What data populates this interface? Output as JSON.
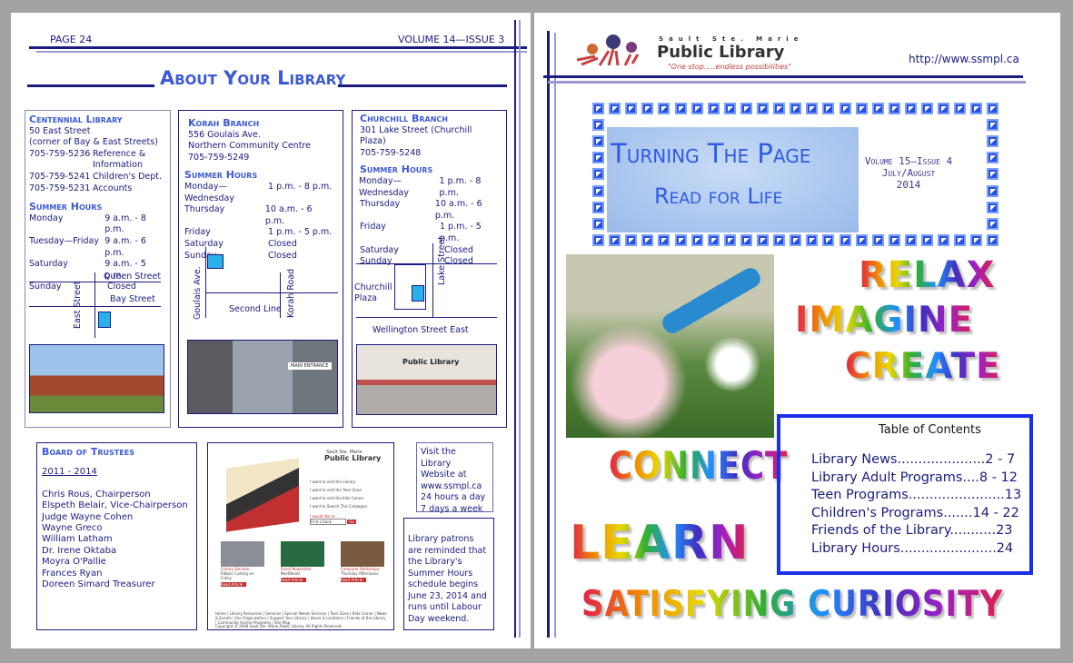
{
  "left": {
    "page_label": "PAGE 24",
    "volume": "VOLUME 14—ISSUE 3",
    "title": "About Your Library",
    "centennial": {
      "name": "Centennial Library",
      "address": "50 East Street",
      "corner": "(corner of Bay & East Streets)",
      "phones": [
        {
          "num": "705-759-5236",
          "dept": "Reference &"
        },
        {
          "num": "",
          "dept": "Information"
        },
        {
          "num": "705-759-5241",
          "dept": "Children's  Dept."
        },
        {
          "num": "705-759-5231",
          "dept": "Accounts"
        }
      ],
      "hours_title": "Summer Hours",
      "hours": [
        {
          "day": "Monday",
          "time": "9 a.m. - 8 p.m."
        },
        {
          "day": "Tuesday—Friday",
          "time": " 9 a.m. - 6 p.m."
        },
        {
          "day": "Saturday",
          "time": "9 a.m. - 5 p.m."
        },
        {
          "day": "Sunday",
          "time": "Closed"
        }
      ],
      "map": {
        "street1": "Queen Street",
        "street2": "Bay Street",
        "street3": "East Street"
      }
    },
    "korah": {
      "name": "Korah Branch",
      "address": "556 Goulais Ave.",
      "centre": "Northern Community Centre",
      "phone": "705-759-5249",
      "hours_title": "Summer Hours",
      "hours": [
        {
          "day": "Monday—Wednesday",
          "time": "1 p.m. -  8 p.m."
        },
        {
          "day": "Thursday",
          "time": "10 a.m. - 6 p.m."
        },
        {
          "day": "Friday",
          "time": "1 p.m. - 5 p.m."
        },
        {
          "day": "Saturday",
          "time": "Closed"
        },
        {
          "day": "Sunday",
          "time": "Closed"
        }
      ],
      "map": {
        "street1": "Goulais Ave.",
        "street2": "Second Line",
        "street3": "Korah Road"
      },
      "photo_sign": "MAIN ENTRANCE"
    },
    "churchill": {
      "name": "Churchill Branch",
      "address": "301 Lake Street  (Churchill Plaza)",
      "phone": "705-759-5248",
      "hours_title": "Summer Hours",
      "hours": [
        {
          "day": "Monday—Wednesday",
          "time": "1 p.m. - 8 p.m."
        },
        {
          "day": "Thursday",
          "time": "10 a.m. - 6 p.m."
        },
        {
          "day": "Friday",
          "time": "1 p.m. - 5 p.m."
        },
        {
          "day": "Saturday",
          "time": "Closed"
        },
        {
          "day": "Sunday",
          "time": "Closed"
        }
      ],
      "map": {
        "street1": "Lake Street",
        "street2": "Churchill Plaza",
        "street3": "Wellington Street East"
      },
      "photo_sign": "Public Library"
    },
    "board": {
      "title": "Board of Trustees",
      "years": "2011 - 2014",
      "members": [
        "Chris Rous, Chairperson",
        "Elspeth Belair, Vice-Chairperson",
        "Judge Wayne Cohen",
        "Wayne Greco",
        "William Latham",
        "Dr. Irene Oktaba",
        "Moyra O'Pallie",
        "Frances Ryan",
        "Doreen Simard Treasurer"
      ]
    },
    "website_shot": {
      "logo_small": "Sault Ste. Marie",
      "logo": "Public Library",
      "links": [
        "I want to visit the Library",
        "I want to visit the Teen Zone",
        "I want to visit the Kids Corner",
        "I want to Search The Catalogue"
      ],
      "would_like": "I would like to ...",
      "select": "Find a book",
      "go": "Go",
      "articles": [
        {
          "title": "Library Elevator",
          "desc": "Ribbon Cutting on Friday"
        },
        {
          "title": "Email Newsletter",
          "desc": "NextReads"
        },
        {
          "title": "Computer Workshops",
          "desc": "Thursday Afternoons"
        }
      ],
      "read": "Read Article",
      "footer": "Home | Library Resources | Services | Special Needs Services | Teen Zone | Kids Corner | News & Events | Our Organization | Support Your Library | Hours & Locations | Friends of the Library | Community Access Programs | Site Map",
      "copyright": "Copyright © 2008 Sault Ste. Marie Public Library. All Rights Reserved."
    },
    "visit": [
      "Visit the Library",
      "Website at",
      "www.ssmpl.ca",
      "24 hours a day",
      "7 days a week"
    ],
    "notice": "Library patrons are reminded that the Library's Summer Hours schedule begins June 23, 2014 and runs until Labour Day weekend."
  },
  "right": {
    "logo": {
      "small": "Sault Ste. Marie",
      "big": "Public Library",
      "tagline": "\"One stop.....endless possibilities\""
    },
    "url": "http://www.ssmpl.ca",
    "banner": {
      "title": "Turning The Page",
      "subtitle": "Read for Life",
      "volume": "Volume 15—Issue 4",
      "month": "July/August",
      "year": "2014"
    },
    "words": [
      "RELAX",
      "IMAGINE",
      "CREATE",
      "CONNECT",
      "LEARN",
      "SATISFYING CURIOSITY"
    ],
    "toc": {
      "title": "Table of Contents",
      "items": [
        "Library News.....................2 - 7",
        "Library Adult Programs....8 - 12",
        "Teen Programs.......................13",
        "Children's Programs.......14 - 22",
        "Friends of the Library...........23",
        "Library Hours.......................24"
      ]
    },
    "colors": {
      "accent": "#1a1a80",
      "title_blue": "#3c5ad8",
      "toc_border": "#1a2fe8"
    }
  }
}
